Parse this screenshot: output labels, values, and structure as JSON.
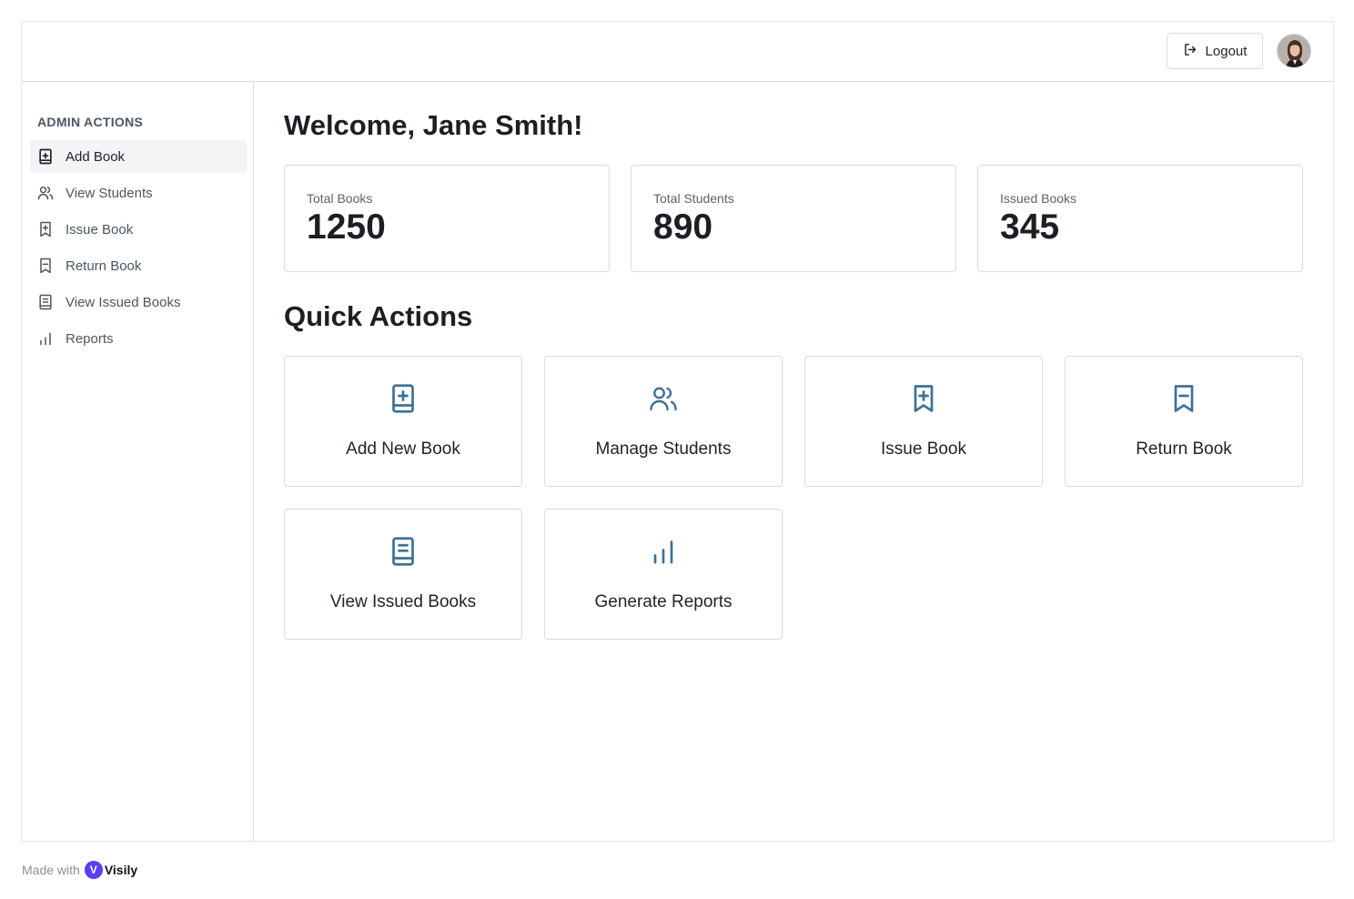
{
  "header": {
    "logout_label": "Logout"
  },
  "sidebar": {
    "title": "ADMIN ACTIONS",
    "items": [
      {
        "label": "Add Book",
        "icon": "book-plus-icon",
        "active": true
      },
      {
        "label": "View Students",
        "icon": "users-icon",
        "active": false
      },
      {
        "label": "Issue Book",
        "icon": "bookmark-plus-icon",
        "active": false
      },
      {
        "label": "Return Book",
        "icon": "bookmark-minus-icon",
        "active": false
      },
      {
        "label": "View Issued Books",
        "icon": "book-list-icon",
        "active": false
      },
      {
        "label": "Reports",
        "icon": "bar-chart-icon",
        "active": false
      }
    ]
  },
  "main": {
    "welcome": "Welcome, Jane Smith!",
    "stats": [
      {
        "label": "Total Books",
        "value": "1250"
      },
      {
        "label": "Total Students",
        "value": "890"
      },
      {
        "label": "Issued Books",
        "value": "345"
      }
    ],
    "quick_actions_title": "Quick Actions",
    "quick_actions": [
      {
        "label": "Add New Book",
        "icon": "book-plus-icon"
      },
      {
        "label": "Manage Students",
        "icon": "users-icon"
      },
      {
        "label": "Issue Book",
        "icon": "bookmark-plus-icon"
      },
      {
        "label": "Return Book",
        "icon": "bookmark-minus-icon"
      },
      {
        "label": "View Issued Books",
        "icon": "book-list-icon"
      },
      {
        "label": "Generate Reports",
        "icon": "bar-chart-icon"
      }
    ]
  },
  "footer": {
    "made_with": "Made with",
    "brand": "Visily"
  },
  "colors": {
    "accent_icon": "#3f7196",
    "border": "#d9dbe0",
    "active_bg": "#f3f4f6"
  }
}
